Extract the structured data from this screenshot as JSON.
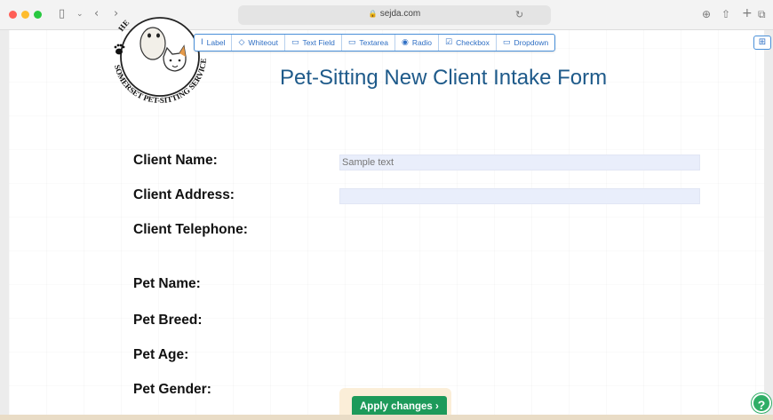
{
  "browser": {
    "url": "sejda.com",
    "icons": [
      "sidebar-icon",
      "chevron-down-icon",
      "back-icon",
      "forward-icon",
      "tab-icon",
      "lock-icon",
      "reload-icon",
      "download-icon",
      "share-icon",
      "new-tab-icon",
      "tabs-overview-icon"
    ]
  },
  "toolbar": {
    "items": [
      {
        "icon": "label-icon",
        "label": "Label"
      },
      {
        "icon": "whiteout-icon",
        "label": "Whiteout"
      },
      {
        "icon": "text-field-icon",
        "label": "Text Field"
      },
      {
        "icon": "textarea-icon",
        "label": "Textarea"
      },
      {
        "icon": "radio-icon",
        "label": "Radio"
      },
      {
        "icon": "checkbox-icon",
        "label": "Checkbox"
      },
      {
        "icon": "dropdown-icon",
        "label": "Dropdown"
      }
    ]
  },
  "logo": {
    "text_bottom": "SOMERSET PET-SITTING SERVICES",
    "text_top_fragment": "HE"
  },
  "form": {
    "title": "Pet-Sitting New Client Intake Form",
    "fields": [
      {
        "label": "Client Name:",
        "value": "",
        "placeholder": "Sample text"
      },
      {
        "label": "Client Address:",
        "value": "",
        "placeholder": ""
      },
      {
        "label": "Client Telephone:"
      },
      {
        "label": "Pet Name:"
      },
      {
        "label": "Pet Breed:"
      },
      {
        "label": "Pet Age:"
      },
      {
        "label": "Pet Gender:"
      }
    ]
  },
  "actions": {
    "apply_label": "Apply changes",
    "help_label": "?"
  },
  "colors": {
    "accent": "#2f6fc4",
    "title": "#1e5a8a",
    "apply": "#1d9a5a",
    "input_bg": "#e9eefb"
  }
}
